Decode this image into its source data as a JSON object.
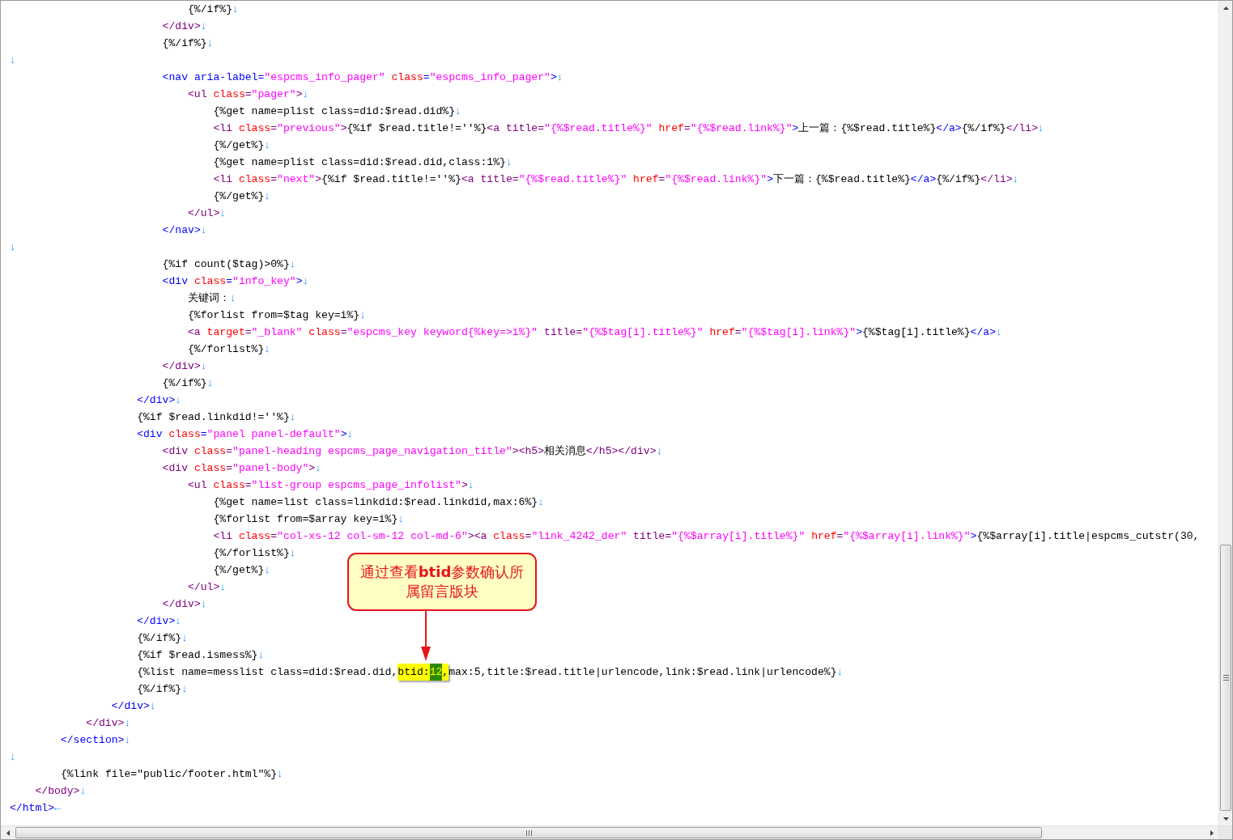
{
  "editor": {
    "lines": [
      {
        "segments": [
          {
            "text": "                            {%/if%}",
            "kind": "plain"
          },
          {
            "text": "↓",
            "kind": "newline"
          }
        ]
      },
      {
        "segments": [
          {
            "text": "                        </div>",
            "kind": "element"
          },
          {
            "text": "↓",
            "kind": "newline"
          }
        ]
      },
      {
        "segments": [
          {
            "text": "                        {%/if%}",
            "kind": "plain"
          },
          {
            "text": "↓",
            "kind": "newline"
          }
        ]
      },
      {
        "segments": [
          {
            "text": "↓",
            "kind": "newline"
          }
        ]
      },
      {
        "segments": [
          {
            "text": "                        <nav aria-label=",
            "kind": "tag"
          },
          {
            "text": "\"espcms_info_pager\"",
            "kind": "string"
          },
          {
            "text": " class",
            "kind": "attribute"
          },
          {
            "text": "=",
            "kind": "tag"
          },
          {
            "text": "\"espcms_info_pager\"",
            "kind": "string"
          },
          {
            "text": ">",
            "kind": "tag"
          },
          {
            "text": "↓",
            "kind": "newline"
          }
        ]
      },
      {
        "segments": [
          {
            "text": "                            <ul",
            "kind": "element"
          },
          {
            "text": " class",
            "kind": "attribute"
          },
          {
            "text": "=",
            "kind": "element"
          },
          {
            "text": "\"pager\"",
            "kind": "string"
          },
          {
            "text": ">",
            "kind": "element"
          },
          {
            "text": "↓",
            "kind": "newline"
          }
        ]
      },
      {
        "segments": [
          {
            "text": "                                {%get name=plist class=did:$read.did%}",
            "kind": "plain"
          },
          {
            "text": "↓",
            "kind": "newline"
          }
        ]
      },
      {
        "segments": [
          {
            "text": "                                <li",
            "kind": "element"
          },
          {
            "text": " class",
            "kind": "attribute"
          },
          {
            "text": "=",
            "kind": "element"
          },
          {
            "text": "\"previous\"",
            "kind": "string"
          },
          {
            "text": ">",
            "kind": "element"
          },
          {
            "text": "{%if $read.title!=''%}",
            "kind": "plain"
          },
          {
            "text": "<a title=",
            "kind": "element"
          },
          {
            "text": "\"{%$read.title%}\"",
            "kind": "string"
          },
          {
            "text": " href",
            "kind": "attribute"
          },
          {
            "text": "=",
            "kind": "element"
          },
          {
            "text": "\"{%$read.link%}\"",
            "kind": "string"
          },
          {
            "text": ">",
            "kind": "tag"
          },
          {
            "text": "上一篇：{%$read.title%}",
            "kind": "plain"
          },
          {
            "text": "</a>",
            "kind": "tag"
          },
          {
            "text": "{%/if%}",
            "kind": "plain"
          },
          {
            "text": "</li>",
            "kind": "element"
          },
          {
            "text": "↓",
            "kind": "newline"
          }
        ]
      },
      {
        "segments": [
          {
            "text": "                                {%/get%}",
            "kind": "plain"
          },
          {
            "text": "↓",
            "kind": "newline"
          }
        ]
      },
      {
        "segments": [
          {
            "text": "                                {%get name=plist class=did:$read.did,class:1%}",
            "kind": "plain"
          },
          {
            "text": "↓",
            "kind": "newline"
          }
        ]
      },
      {
        "segments": [
          {
            "text": "                                <li",
            "kind": "element"
          },
          {
            "text": " class",
            "kind": "attribute"
          },
          {
            "text": "=",
            "kind": "element"
          },
          {
            "text": "\"next\"",
            "kind": "string"
          },
          {
            "text": ">",
            "kind": "element"
          },
          {
            "text": "{%if $read.title!=''%}",
            "kind": "plain"
          },
          {
            "text": "<a title=",
            "kind": "element"
          },
          {
            "text": "\"{%$read.title%}\"",
            "kind": "string"
          },
          {
            "text": " href",
            "kind": "attribute"
          },
          {
            "text": "=",
            "kind": "element"
          },
          {
            "text": "\"{%$read.link%}\"",
            "kind": "string"
          },
          {
            "text": ">",
            "kind": "tag"
          },
          {
            "text": "下一篇：{%$read.title%}",
            "kind": "plain"
          },
          {
            "text": "</a>",
            "kind": "tag"
          },
          {
            "text": "{%/if%}",
            "kind": "plain"
          },
          {
            "text": "</li>",
            "kind": "element"
          },
          {
            "text": "↓",
            "kind": "newline"
          }
        ]
      },
      {
        "segments": [
          {
            "text": "                                {%/get%}",
            "kind": "plain"
          },
          {
            "text": "↓",
            "kind": "newline"
          }
        ]
      },
      {
        "segments": [
          {
            "text": "                            </ul>",
            "kind": "element"
          },
          {
            "text": "↓",
            "kind": "newline"
          }
        ]
      },
      {
        "segments": [
          {
            "text": "                        </nav>",
            "kind": "tag"
          },
          {
            "text": "↓",
            "kind": "newline"
          }
        ]
      },
      {
        "segments": [
          {
            "text": "↓",
            "kind": "newline"
          }
        ]
      },
      {
        "segments": [
          {
            "text": "                        {%if count($tag)>0%}",
            "kind": "plain"
          },
          {
            "text": "↓",
            "kind": "newline"
          }
        ]
      },
      {
        "segments": [
          {
            "text": "                        <div",
            "kind": "tag"
          },
          {
            "text": " class",
            "kind": "attribute"
          },
          {
            "text": "=",
            "kind": "tag"
          },
          {
            "text": "\"info_key\"",
            "kind": "string"
          },
          {
            "text": ">",
            "kind": "tag"
          },
          {
            "text": "↓",
            "kind": "newline"
          }
        ]
      },
      {
        "segments": [
          {
            "text": "                            关键词：",
            "kind": "plain"
          },
          {
            "text": "↓",
            "kind": "newline"
          }
        ]
      },
      {
        "segments": [
          {
            "text": "                            {%forlist from=$tag key=i%}",
            "kind": "plain"
          },
          {
            "text": "↓",
            "kind": "newline"
          }
        ]
      },
      {
        "segments": [
          {
            "text": "                            <a",
            "kind": "element"
          },
          {
            "text": " target",
            "kind": "attribute"
          },
          {
            "text": "=",
            "kind": "element"
          },
          {
            "text": "\"_blank\"",
            "kind": "string"
          },
          {
            "text": " class",
            "kind": "attribute"
          },
          {
            "text": "=",
            "kind": "element"
          },
          {
            "text": "\"espcms_key keyword{%key=>i%}\"",
            "kind": "string"
          },
          {
            "text": " title=",
            "kind": "element"
          },
          {
            "text": "\"{%$tag[i].title%}\"",
            "kind": "string"
          },
          {
            "text": " href",
            "kind": "attribute"
          },
          {
            "text": "=",
            "kind": "element"
          },
          {
            "text": "\"{%$tag[i].link%}\"",
            "kind": "string"
          },
          {
            "text": ">",
            "kind": "tag"
          },
          {
            "text": "{%$tag[i].title%}",
            "kind": "plain"
          },
          {
            "text": "</a>",
            "kind": "tag"
          },
          {
            "text": "↓",
            "kind": "newline"
          }
        ]
      },
      {
        "segments": [
          {
            "text": "                            {%/forlist%}",
            "kind": "plain"
          },
          {
            "text": "↓",
            "kind": "newline"
          }
        ]
      },
      {
        "segments": [
          {
            "text": "                        </div>",
            "kind": "element"
          },
          {
            "text": "↓",
            "kind": "newline"
          }
        ]
      },
      {
        "segments": [
          {
            "text": "                        {%/if%}",
            "kind": "plain"
          },
          {
            "text": "↓",
            "kind": "newline"
          }
        ]
      },
      {
        "segments": [
          {
            "text": "                    </div>",
            "kind": "tag"
          },
          {
            "text": "↓",
            "kind": "newline"
          }
        ]
      },
      {
        "segments": [
          {
            "text": "                    {%if $read.linkdid!=''%}",
            "kind": "plain"
          },
          {
            "text": "↓",
            "kind": "newline"
          }
        ]
      },
      {
        "segments": [
          {
            "text": "                    <div",
            "kind": "tag"
          },
          {
            "text": " class",
            "kind": "attribute"
          },
          {
            "text": "=",
            "kind": "tag"
          },
          {
            "text": "\"panel panel-default\"",
            "kind": "string"
          },
          {
            "text": ">",
            "kind": "tag"
          },
          {
            "text": "↓",
            "kind": "newline"
          }
        ]
      },
      {
        "segments": [
          {
            "text": "                        <div",
            "kind": "element"
          },
          {
            "text": " class",
            "kind": "attribute"
          },
          {
            "text": "=",
            "kind": "element"
          },
          {
            "text": "\"panel-heading espcms_page_navigation_title\"",
            "kind": "string"
          },
          {
            "text": "><h5>",
            "kind": "element"
          },
          {
            "text": "相关消息",
            "kind": "plain"
          },
          {
            "text": "</h5></div>",
            "kind": "element"
          },
          {
            "text": "↓",
            "kind": "newline"
          }
        ]
      },
      {
        "segments": [
          {
            "text": "                        <div",
            "kind": "element"
          },
          {
            "text": " class",
            "kind": "attribute"
          },
          {
            "text": "=",
            "kind": "element"
          },
          {
            "text": "\"panel-body\"",
            "kind": "string"
          },
          {
            "text": ">",
            "kind": "element"
          },
          {
            "text": "↓",
            "kind": "newline"
          }
        ]
      },
      {
        "segments": [
          {
            "text": "                            <ul",
            "kind": "element"
          },
          {
            "text": " class",
            "kind": "attribute"
          },
          {
            "text": "=",
            "kind": "element"
          },
          {
            "text": "\"list-group espcms_page_infolist\"",
            "kind": "string"
          },
          {
            "text": ">",
            "kind": "element"
          },
          {
            "text": "↓",
            "kind": "newline"
          }
        ]
      },
      {
        "segments": [
          {
            "text": "                                {%get name=list class=linkdid:$read.linkdid,max:6%}",
            "kind": "plain"
          },
          {
            "text": "↓",
            "kind": "newline"
          }
        ]
      },
      {
        "segments": [
          {
            "text": "                                {%forlist from=$array key=i%}",
            "kind": "plain"
          },
          {
            "text": "↓",
            "kind": "newline"
          }
        ]
      },
      {
        "segments": [
          {
            "text": "                                <li",
            "kind": "element"
          },
          {
            "text": " class",
            "kind": "attribute"
          },
          {
            "text": "=",
            "kind": "element"
          },
          {
            "text": "\"col-xs-12 col-sm-12 col-md-6\"",
            "kind": "string"
          },
          {
            "text": "><a",
            "kind": "element"
          },
          {
            "text": " class",
            "kind": "attribute"
          },
          {
            "text": "=",
            "kind": "element"
          },
          {
            "text": "\"link_4242_der\"",
            "kind": "string"
          },
          {
            "text": " title=",
            "kind": "element"
          },
          {
            "text": "\"{%$array[i].title%}\"",
            "kind": "string"
          },
          {
            "text": " href",
            "kind": "attribute"
          },
          {
            "text": "=",
            "kind": "element"
          },
          {
            "text": "\"{%$array[i].link%}\"",
            "kind": "string"
          },
          {
            "text": ">",
            "kind": "tag"
          },
          {
            "text": "{%$array[i].title|espcms_cutstr(30,",
            "kind": "plain"
          }
        ]
      },
      {
        "segments": [
          {
            "text": "                                {%/forlist%}",
            "kind": "plain"
          },
          {
            "text": "↓",
            "kind": "newline"
          }
        ]
      },
      {
        "segments": [
          {
            "text": "                                {%/get%}",
            "kind": "plain"
          },
          {
            "text": "↓",
            "kind": "newline"
          }
        ]
      },
      {
        "segments": [
          {
            "text": "                            </ul>",
            "kind": "element"
          },
          {
            "text": "↓",
            "kind": "newline"
          }
        ]
      },
      {
        "segments": [
          {
            "text": "                        </div>",
            "kind": "element"
          },
          {
            "text": "↓",
            "kind": "newline"
          }
        ]
      },
      {
        "segments": [
          {
            "text": "                    </div>",
            "kind": "tag"
          },
          {
            "text": "↓",
            "kind": "newline"
          }
        ]
      },
      {
        "segments": [
          {
            "text": "                    {%/if%}",
            "kind": "plain"
          },
          {
            "text": "↓",
            "kind": "newline"
          }
        ]
      },
      {
        "segments": [
          {
            "text": "                    {%if $read.ismess%}",
            "kind": "plain"
          },
          {
            "text": "↓",
            "kind": "newline"
          }
        ]
      },
      {
        "segments": [
          {
            "text": "                    {%list name=messlist class=did:$read.did,",
            "kind": "plain"
          },
          {
            "text": "btid:",
            "kind": "highlight"
          },
          {
            "text": "12",
            "kind": "selection"
          },
          {
            "text": ",",
            "kind": "highlight"
          },
          {
            "text": "max:5,title:$read.title|urlencode,link:$read.link|urlencode%}",
            "kind": "plain"
          },
          {
            "text": "↓",
            "kind": "newline"
          }
        ]
      },
      {
        "segments": [
          {
            "text": "                    {%/if%}",
            "kind": "plain"
          },
          {
            "text": "↓",
            "kind": "newline"
          }
        ]
      },
      {
        "segments": [
          {
            "text": "                </div>",
            "kind": "tag"
          },
          {
            "text": "↓",
            "kind": "newline"
          }
        ]
      },
      {
        "segments": [
          {
            "text": "            </div>",
            "kind": "element"
          },
          {
            "text": "↓",
            "kind": "newline"
          }
        ]
      },
      {
        "segments": [
          {
            "text": "        </section>",
            "kind": "tag"
          },
          {
            "text": "↓",
            "kind": "newline"
          }
        ]
      },
      {
        "segments": [
          {
            "text": "↓",
            "kind": "newline"
          }
        ]
      },
      {
        "segments": [
          {
            "text": "        {%link file=\"public/footer.html\"%}",
            "kind": "plain"
          },
          {
            "text": "↓",
            "kind": "newline"
          }
        ]
      },
      {
        "segments": [
          {
            "text": "    </body>",
            "kind": "element"
          },
          {
            "text": "↓",
            "kind": "newline"
          }
        ]
      },
      {
        "segments": [
          {
            "text": "</html>",
            "kind": "tag"
          },
          {
            "text": "←",
            "kind": "newline"
          }
        ]
      }
    ]
  },
  "callout": {
    "text": "通过查看**btid**参数确认所属留言版块"
  }
}
